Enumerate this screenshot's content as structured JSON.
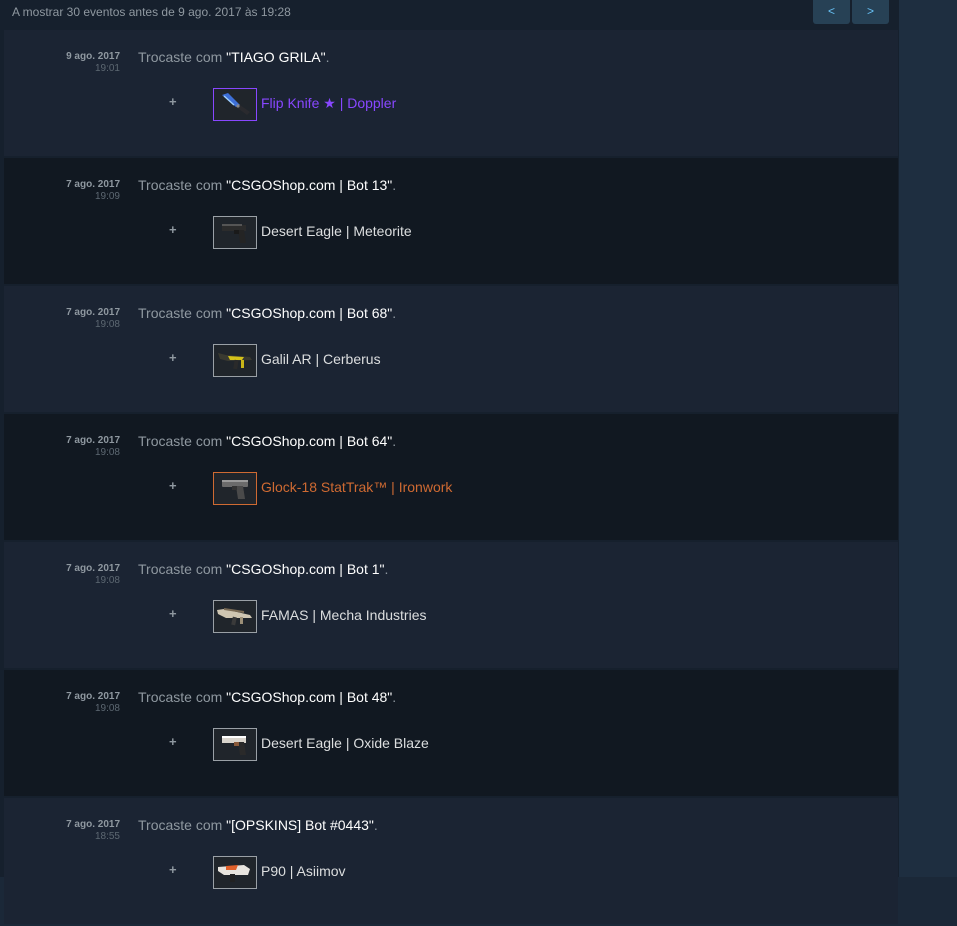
{
  "header": {
    "summary": "A mostrar 30 eventos antes de 9 ago. 2017 às 19:28",
    "prev_label": "<",
    "next_label": ">"
  },
  "colors": {
    "default_item": "#dcdedf",
    "covert_knife": "#8847ff",
    "stattrak": "#cf6a32",
    "partner": "#ffffff"
  },
  "events": [
    {
      "date": "9 ago. 2017",
      "time": "19:01",
      "text_before": "Trocaste com ",
      "partner": "\"TIAGO GRILA\"",
      "text_after": ".",
      "plus": "+",
      "item_name": "Flip Knife ★ | Doppler",
      "item_color": "#8847ff",
      "icon": "flip-knife-icon"
    },
    {
      "date": "7 ago. 2017",
      "time": "19:09",
      "text_before": "Trocaste com ",
      "partner": "\"CSGOShop.com | Bot 13\"",
      "text_after": ".",
      "plus": "+",
      "item_name": "Desert Eagle | Meteorite",
      "item_color": "#dcdedf",
      "icon": "desert-eagle-icon"
    },
    {
      "date": "7 ago. 2017",
      "time": "19:08",
      "text_before": "Trocaste com ",
      "partner": "\"CSGOShop.com | Bot 68\"",
      "text_after": ".",
      "plus": "+",
      "item_name": "Galil AR | Cerberus",
      "item_color": "#dcdedf",
      "icon": "galil-ar-icon"
    },
    {
      "date": "7 ago. 2017",
      "time": "19:08",
      "text_before": "Trocaste com ",
      "partner": "\"CSGOShop.com | Bot 64\"",
      "text_after": ".",
      "plus": "+",
      "item_name": "Glock-18 StatTrak™ | Ironwork",
      "item_color": "#cf6a32",
      "icon": "glock-icon"
    },
    {
      "date": "7 ago. 2017",
      "time": "19:08",
      "text_before": "Trocaste com ",
      "partner": "\"CSGOShop.com | Bot 1\"",
      "text_after": ".",
      "plus": "+",
      "item_name": "FAMAS | Mecha Industries",
      "item_color": "#dcdedf",
      "icon": "famas-icon"
    },
    {
      "date": "7 ago. 2017",
      "time": "19:08",
      "text_before": "Trocaste com ",
      "partner": "\"CSGOShop.com | Bot 48\"",
      "text_after": ".",
      "plus": "+",
      "item_name": "Desert Eagle | Oxide Blaze",
      "item_color": "#dcdedf",
      "icon": "desert-eagle-icon"
    },
    {
      "date": "7 ago. 2017",
      "time": "18:55",
      "text_before": "Trocaste com ",
      "partner": "\"[OPSKINS] Bot #0443\"",
      "text_after": ".",
      "plus": "+",
      "item_name": "P90 | Asiimov",
      "item_color": "#dcdedf",
      "icon": "p90-icon"
    }
  ]
}
